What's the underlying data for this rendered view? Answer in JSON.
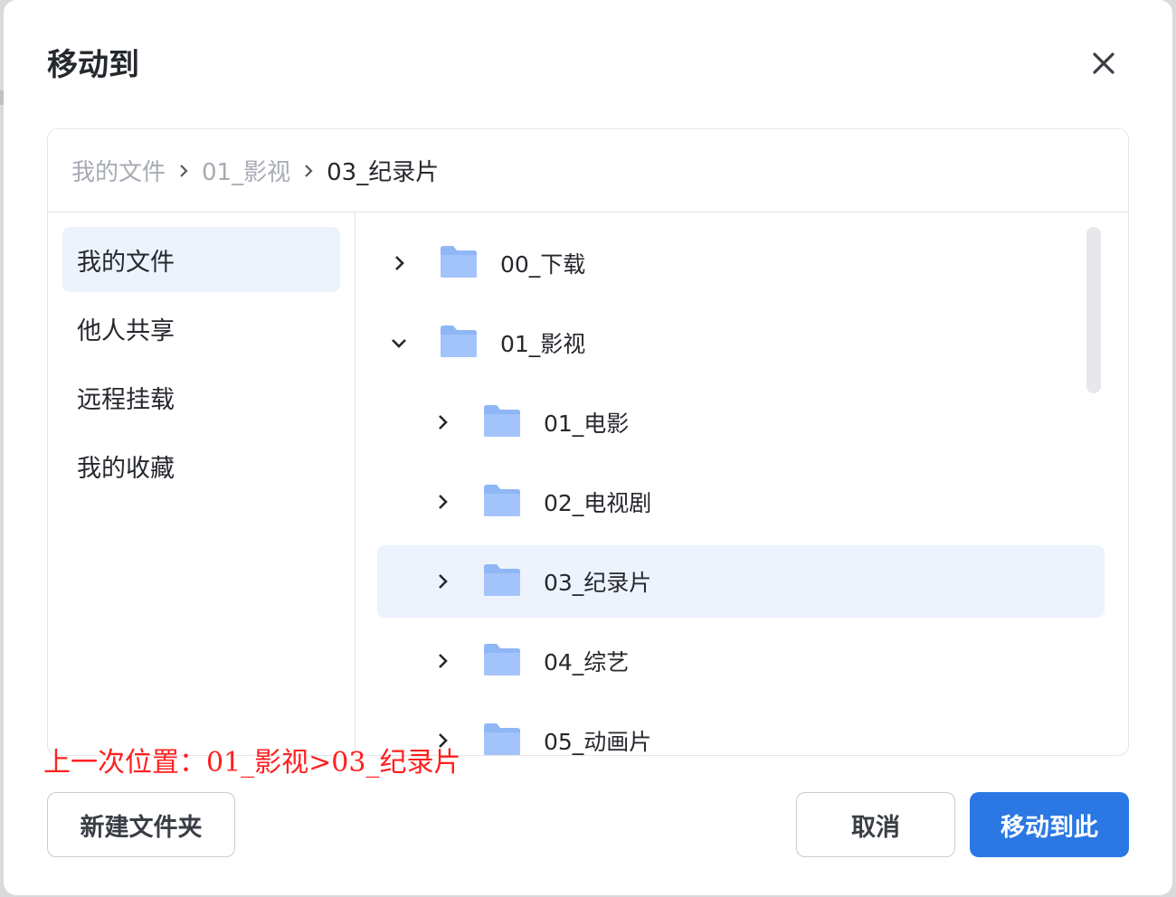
{
  "dialog": {
    "title": "移动到",
    "close_icon": "close-icon"
  },
  "breadcrumb": [
    {
      "label": "我的文件",
      "current": false
    },
    {
      "label": "01_影视",
      "current": false
    },
    {
      "label": "03_纪录片",
      "current": true
    }
  ],
  "sidebar": {
    "items": [
      {
        "label": "我的文件",
        "active": true
      },
      {
        "label": "他人共享",
        "active": false
      },
      {
        "label": "远程挂载",
        "active": false
      },
      {
        "label": "我的收藏",
        "active": false
      }
    ]
  },
  "tree": {
    "items": [
      {
        "label": "00_下载",
        "level": 0,
        "expanded": false,
        "selected": false
      },
      {
        "label": "01_影视",
        "level": 0,
        "expanded": true,
        "selected": false
      },
      {
        "label": "01_电影",
        "level": 1,
        "expanded": false,
        "selected": false
      },
      {
        "label": "02_电视剧",
        "level": 1,
        "expanded": false,
        "selected": false
      },
      {
        "label": "03_纪录片",
        "level": 1,
        "expanded": false,
        "selected": true
      },
      {
        "label": "04_综艺",
        "level": 1,
        "expanded": false,
        "selected": false
      },
      {
        "label": "05_动画片",
        "level": 1,
        "expanded": false,
        "selected": false
      }
    ]
  },
  "note": "上一次位置：01_影视>03_纪录片",
  "buttons": {
    "new_folder": "新建文件夹",
    "cancel": "取消",
    "move_here": "移动到此"
  },
  "colors": {
    "accent": "#2b78e4",
    "selected_bg": "#edf3fd",
    "folder": "#8fb6f5",
    "note": "#ff2020"
  }
}
